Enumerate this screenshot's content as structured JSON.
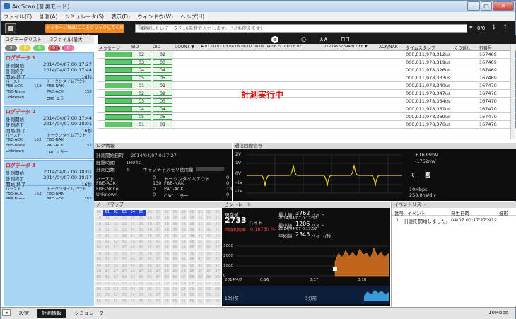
{
  "title": "ArcScan [計測モード]",
  "menu": [
    "ファイル(F)",
    "計測(A)",
    "シミュレータ(S)",
    "表示(D)",
    "ウィンドウ(W)",
    "ヘルプ(H)"
  ],
  "toolbar": {
    "msg_button": "メッセージ抽出(ここをクリックしてください)",
    "search_placeholder": "検索したいデータを16進数で入力します。(*,?も使えます)",
    "count": "0/0"
  },
  "sidebar": {
    "header": "ログデータリスト",
    "header_count": "3ファイル(最大1000)",
    "badges": [
      "3",
      "0",
      "0",
      "0",
      "0"
    ],
    "logs": [
      {
        "name": "ログデータ 1",
        "start_label": "計測開始",
        "start": "2014/04/07 00:17:27",
        "end_label": "計測終了",
        "end": "2014/04/07 00:17:44",
        "dur_label": "開始-終了",
        "dur": "16秒",
        "c1": "バースト",
        "c1v": "",
        "c2": "トークンタイムアウト",
        "c2v": "",
        "c3": "FBE-ACK",
        "c3v": "152",
        "c4": "FBE-NAK",
        "c4v": "",
        "c5": "FBE-None",
        "c5v": "",
        "c6": "PAC-ACK",
        "c6v": "152",
        "c7": "Unknown",
        "c7v": "",
        "c8": "CRC エラー",
        "c8v": ""
      },
      {
        "name": "ログデータ 2",
        "start_label": "計測開始",
        "start": "2014/04/07 00:17:44",
        "end_label": "計測終了",
        "end": "2014/04/07 00:18:01",
        "dur_label": "開始-終了",
        "dur": "16秒",
        "c1": "バースト",
        "c1v": "",
        "c2": "トークンタイムアウト",
        "c2v": "",
        "c3": "FBE-ACK",
        "c3v": "152",
        "c4": "FBE-NAK",
        "c4v": "",
        "c5": "FBE-None",
        "c5v": "",
        "c6": "PAC-ACK",
        "c6v": "152",
        "c7": "Unknown",
        "c7v": "",
        "c8": "CRC エラー",
        "c8v": ""
      },
      {
        "name": "ログデータ 3",
        "start_label": "計測開始",
        "start": "2014/04/07 00:18:01",
        "end_label": "計測終了",
        "end": "2014/04/07 00:18:17",
        "dur_label": "開始-終了",
        "dur": "16秒",
        "c1": "バースト",
        "c1v": "",
        "c2": "トークンタイムアウト",
        "c2v": "",
        "c3": "FBE-ACK",
        "c3v": "152",
        "c4": "FBE-NAK",
        "c4v": "",
        "c5": "FBE-None",
        "c5v": "",
        "c6": "PAC-ACK",
        "c6v": "152",
        "c7": "Unknown",
        "c7v": "",
        "c8": "CRC エラー",
        "c8v": ""
      }
    ]
  },
  "grid": {
    "cols": [
      "メッセージ",
      "SID",
      "DID",
      "COUNT ▼",
      "▶ 01 00 02 03 04 05 06 07 08 09 0A 0B 0C 0D 0E 0F",
      "0123456789ABCDEF ▼",
      "ACK/NAK",
      "タイムスタンプ",
      "くり返し",
      "行番号"
    ],
    "rows": [
      [
        "02",
        "02",
        "000,011,978,312us",
        "167469"
      ],
      [
        "03",
        "03",
        "000,011,978,319us",
        "167469"
      ],
      [
        "04",
        "04",
        "000,011,978,326us",
        "167469"
      ],
      [
        "05",
        "05",
        "000,011,978,333us",
        "167469"
      ],
      [
        "01",
        "01",
        "000,011,978,340us",
        "167470"
      ],
      [
        "02",
        "02",
        "000,011,978,347us",
        "167470"
      ],
      [
        "03",
        "03",
        "000,011,978,354us",
        "167470"
      ],
      [
        "04",
        "04",
        "000,011,978,361us",
        "167470"
      ],
      [
        "05",
        "05",
        "000,011,978,369us",
        "167470"
      ],
      [
        "01",
        "01",
        "000,011,978,376us",
        "167470"
      ]
    ],
    "overlay": "計測実行中"
  },
  "loginfo": {
    "title": "ログ情報",
    "start_label": "計測開始日時",
    "start": "2014/04/07 0:17:27",
    "elapsed_label": "経過時間",
    "elapsed": "1H04s",
    "count_label": "計測回数",
    "count": "4",
    "mem_label": "キャプチャメモリ使用量",
    "stats": [
      [
        "バースト",
        "0"
      ],
      [
        "トークンタイムアウト",
        "0"
      ],
      [
        "FBE-ACK",
        "130"
      ],
      [
        "FBE-NAK",
        "0"
      ],
      [
        "FBE-None",
        "0"
      ],
      [
        "PAC-ACK",
        "130"
      ],
      [
        "Unknown",
        "0"
      ],
      [
        "CRC エラー",
        "0"
      ]
    ]
  },
  "wave": {
    "title": "通信回線信号",
    "ylabels": [
      "2V",
      "1V",
      "0V",
      "-1V",
      "-2V"
    ],
    "up": "+1633mV",
    "down": "-1762mV",
    "rate": "10Mbps",
    "div": "250.0ns/div"
  },
  "nodemap": {
    "title": "ノードマップ"
  },
  "bitrate": {
    "title": "ビットレート",
    "cur_label": "現在値",
    "cur": "2733",
    "unit": "バイト",
    "rate_label": "回線利用率",
    "rate": "0.18760 %",
    "max_label": "最大値",
    "max": "3762",
    "max_t": "2014/04/07 0:17:37",
    "min_label": "最小値",
    "min": "1206",
    "min_t": "2014/04/07 0:17:57",
    "avg_label": "平均値",
    "avg": "2345",
    "avg_unit": "バイト/秒",
    "ylabels": [
      "3000",
      "2000",
      "1000",
      "0"
    ],
    "xlabels": [
      "2014/4/7",
      "0:16",
      "0:17",
      "0:18"
    ],
    "mini_l": "10分前",
    "mini_r": "5分前"
  },
  "events": {
    "title": "イベントリスト",
    "cols": [
      "番号",
      "イベント",
      "発生日時",
      "波形"
    ],
    "rows": [
      [
        "1",
        "計測を開始しました。",
        "04/07 00:17'27\"912",
        ""
      ]
    ]
  },
  "bottom": {
    "tabs": [
      "設定",
      "計測情報",
      "シミュレータ"
    ],
    "speed": "10Mbps"
  }
}
